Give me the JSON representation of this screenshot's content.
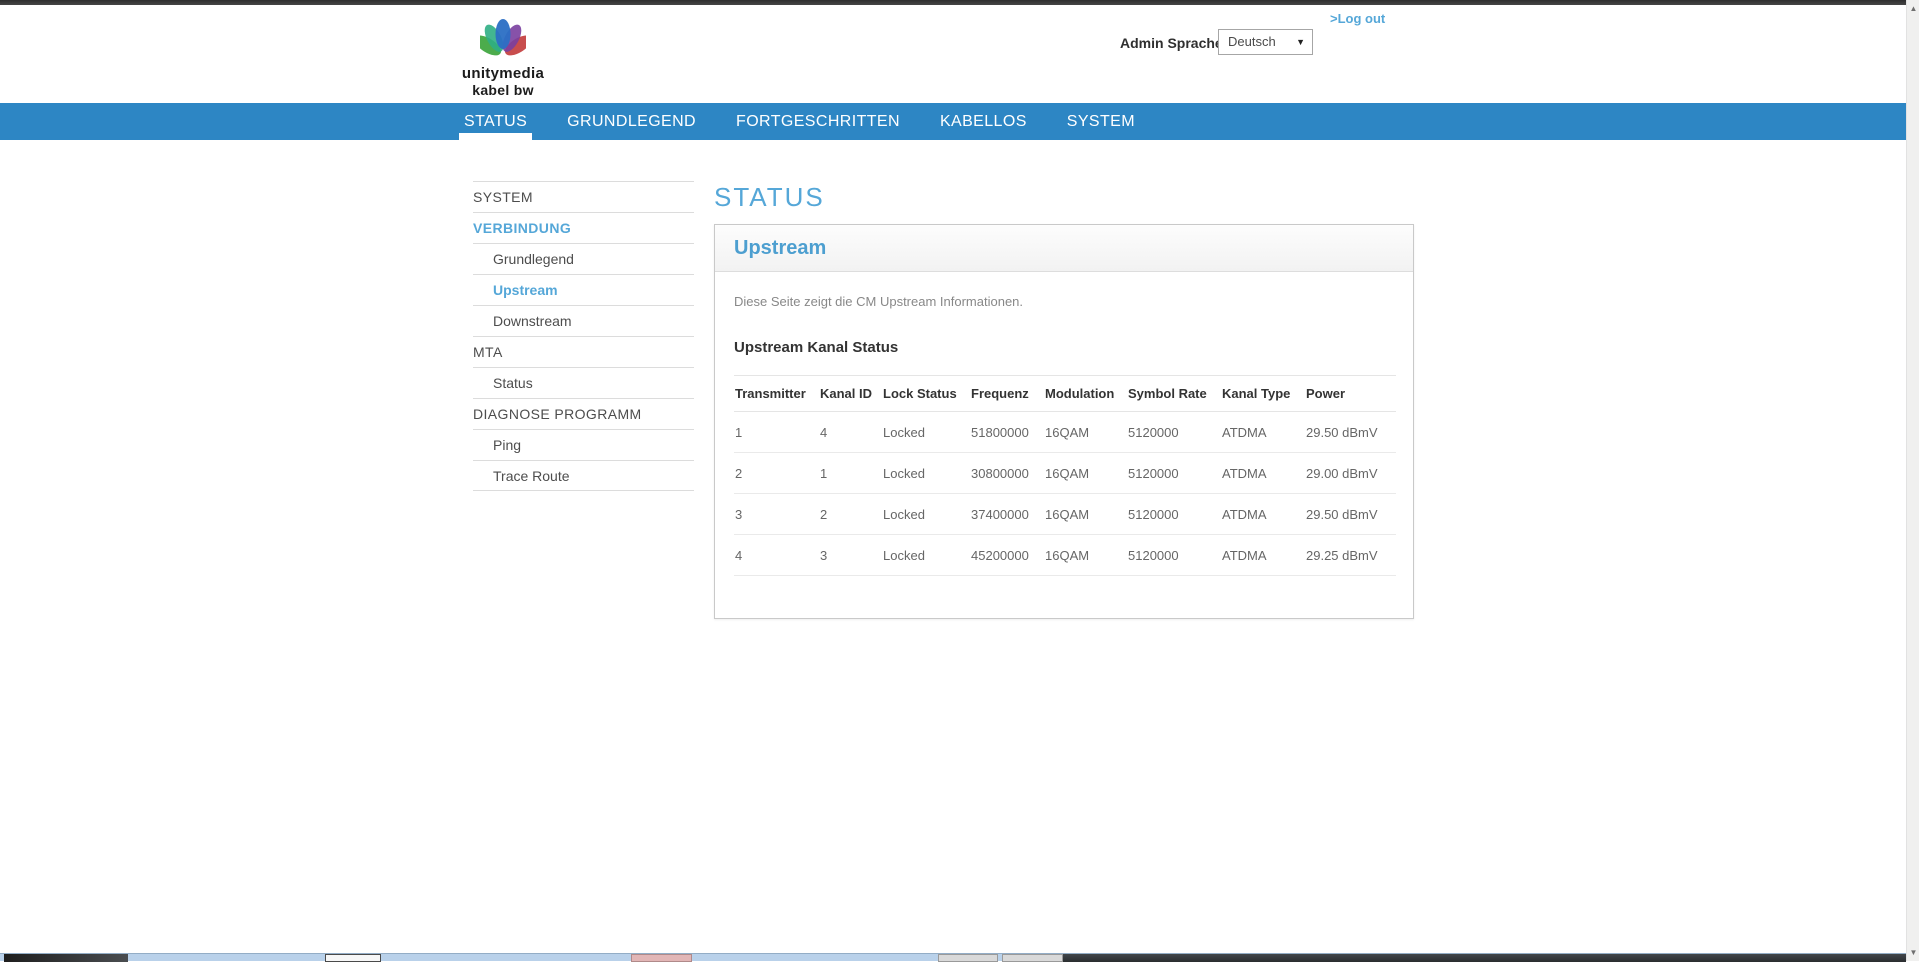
{
  "header": {
    "logo_line1": "unitymedia",
    "logo_line2": "kabel bw",
    "logout_label": ">Log out",
    "language_label": "Admin Sprache",
    "language_value": "Deutsch"
  },
  "nav": {
    "items": [
      {
        "label": "STATUS",
        "active": true
      },
      {
        "label": "GRUNDLEGEND",
        "active": false
      },
      {
        "label": "FORTGESCHRITTEN",
        "active": false
      },
      {
        "label": "KABELLOS",
        "active": false
      },
      {
        "label": "SYSTEM",
        "active": false
      }
    ]
  },
  "sidebar": {
    "items": [
      {
        "label": "SYSTEM",
        "type": "section",
        "active": false
      },
      {
        "label": "VERBINDUNG",
        "type": "section",
        "active": true
      },
      {
        "label": "Grundlegend",
        "type": "sub",
        "active": false
      },
      {
        "label": "Upstream",
        "type": "sub",
        "active": true
      },
      {
        "label": "Downstream",
        "type": "sub",
        "active": false
      },
      {
        "label": "MTA",
        "type": "section",
        "active": false
      },
      {
        "label": "Status",
        "type": "sub",
        "active": false
      },
      {
        "label": "DIAGNOSE PROGRAMM",
        "type": "section",
        "active": false
      },
      {
        "label": "Ping",
        "type": "sub",
        "active": false
      },
      {
        "label": "Trace Route",
        "type": "sub",
        "active": false
      }
    ]
  },
  "main": {
    "page_title": "STATUS",
    "panel_title": "Upstream",
    "description": "Diese Seite zeigt die CM Upstream Informationen.",
    "table_title": "Upstream Kanal Status",
    "table": {
      "headers": [
        "Transmitter",
        "Kanal ID",
        "Lock Status",
        "Frequenz",
        "Modulation",
        "Symbol Rate",
        "Kanal Type",
        "Power"
      ],
      "rows": [
        [
          "1",
          "4",
          "Locked",
          "51800000",
          "16QAM",
          "5120000",
          "ATDMA",
          "29.50 dBmV"
        ],
        [
          "2",
          "1",
          "Locked",
          "30800000",
          "16QAM",
          "5120000",
          "ATDMA",
          "29.00 dBmV"
        ],
        [
          "3",
          "2",
          "Locked",
          "37400000",
          "16QAM",
          "5120000",
          "ATDMA",
          "29.50 dBmV"
        ],
        [
          "4",
          "3",
          "Locked",
          "45200000",
          "16QAM",
          "5120000",
          "ATDMA",
          "29.25 dBmV"
        ]
      ]
    }
  },
  "colors": {
    "nav_blue": "#2d86c4",
    "accent_link_blue": "#55a7d8",
    "panel_title_blue": "#4d9fd0",
    "sidebar_text": "#4d4d4d",
    "table_text": "#666666"
  }
}
